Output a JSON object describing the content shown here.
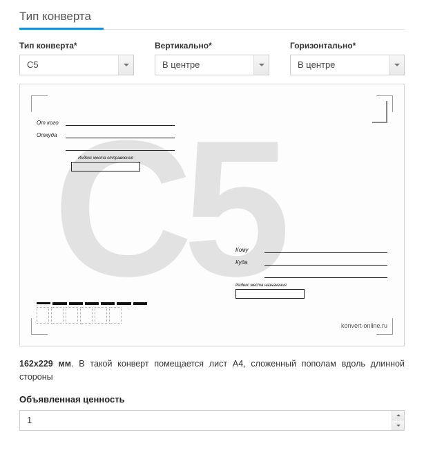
{
  "section_title": "Тип конверта",
  "fields": {
    "type": {
      "label": "Тип конверта*",
      "value": "C5"
    },
    "vertical": {
      "label": "Вертикально*",
      "value": "В центре"
    },
    "horizontal": {
      "label": "Горизонтально*",
      "value": "В центре"
    }
  },
  "envelope": {
    "watermark_text": "C5",
    "from_label": "От кого",
    "from_addr_label": "Откуда",
    "to_label": "Кому",
    "to_addr_label": "Куда",
    "sender_index_label": "Индекс места отправления",
    "dest_index_label": "Индекс места назначения",
    "site_watermark": "konvert-online.ru"
  },
  "description": {
    "size_bold": "162х229 мм",
    "rest": ". В такой конверт помещается лист А4, сложенный пополам вдоль длинной стороны"
  },
  "declared_value": {
    "label": "Объявленная ценность",
    "value": "1"
  }
}
